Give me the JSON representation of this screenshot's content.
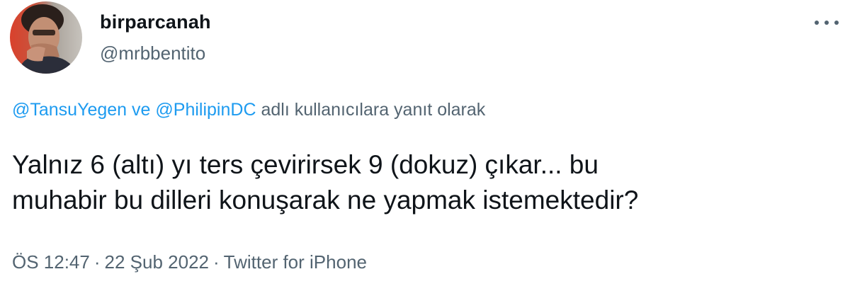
{
  "user": {
    "display_name": "birparcanah",
    "handle": "@mrbbentito"
  },
  "reply_context": {
    "mention_1": "@TansuYegen",
    "connector": "ve",
    "mention_2": "@PhilipinDC",
    "suffix": "adlı kullanıcılara yanıt olarak"
  },
  "tweet": {
    "line_1": "Yalnız 6 (altı) yı ters çevirirsek 9 (dokuz) çıkar... bu",
    "line_2": "muhabir bu dilleri konuşarak ne yapmak istemektedir?"
  },
  "meta": {
    "time": "ÖS 12:47",
    "separator": "·",
    "date": "22 Şub 2022",
    "source": "Twitter for iPhone"
  },
  "icons": {
    "more": "more-horizontal-icon",
    "avatar": "profile-photo"
  },
  "colors": {
    "text": "#0f1419",
    "secondary": "#536471",
    "link": "#1d9bf0",
    "background": "#ffffff"
  }
}
